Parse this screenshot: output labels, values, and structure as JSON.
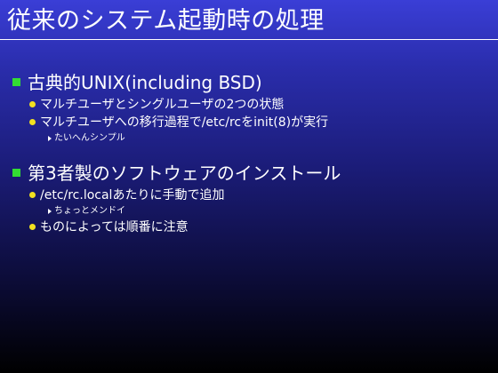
{
  "slide": {
    "title": "従来のシステム起動時の処理",
    "sections": [
      {
        "heading": "古典的UNIX(including BSD)",
        "items": [
          {
            "text": "マルチユーザとシングルユーザの2つの状態"
          },
          {
            "text": "マルチユーザへの移行過程で/etc/rcをinit(8)が実行"
          }
        ],
        "sub_item": "たいへんシンプル"
      },
      {
        "heading": "第3者製のソフトウェアのインストール",
        "items": [
          {
            "text": "/etc/rc.localあたりに手動で追加"
          },
          {
            "text": "ものによっては順番に注意"
          }
        ],
        "sub_item": "ちょっとメンドイ"
      }
    ]
  },
  "colors": {
    "background_top": "#3a3ed6",
    "background_bottom": "#000000",
    "level1_bullet": "#33dd33",
    "level2_bullet": "#f2e020",
    "text": "#ffffff"
  },
  "icons": {
    "level1_bullet": "green-square-bullet-icon",
    "level2_bullet": "yellow-dot-bullet-icon",
    "level3_bullet": "white-triangle-bullet-icon"
  }
}
